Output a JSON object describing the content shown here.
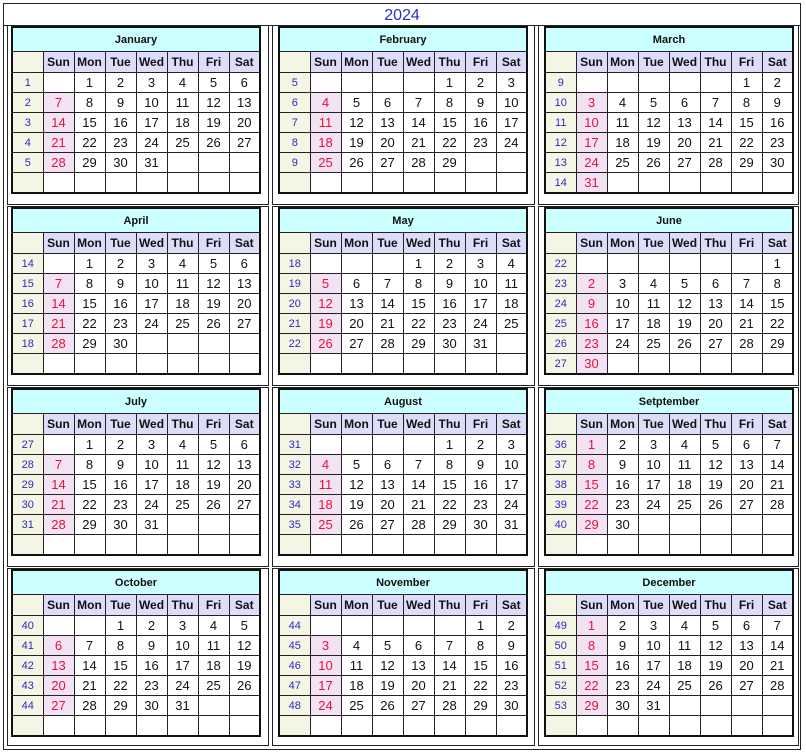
{
  "title": "2024",
  "day_headers": [
    "Sun",
    "Mon",
    "Tue",
    "Wed",
    "Thu",
    "Fri",
    "Sat"
  ],
  "months": [
    {
      "name": "January",
      "rows": [
        {
          "week": "1",
          "days": [
            "",
            "1",
            "2",
            "3",
            "4",
            "5",
            "6"
          ]
        },
        {
          "week": "2",
          "days": [
            "7",
            "8",
            "9",
            "10",
            "11",
            "12",
            "13"
          ]
        },
        {
          "week": "3",
          "days": [
            "14",
            "15",
            "16",
            "17",
            "18",
            "19",
            "20"
          ]
        },
        {
          "week": "4",
          "days": [
            "21",
            "22",
            "23",
            "24",
            "25",
            "26",
            "27"
          ]
        },
        {
          "week": "5",
          "days": [
            "28",
            "29",
            "30",
            "31",
            "",
            "",
            ""
          ]
        },
        {
          "week": "",
          "days": [
            "",
            "",
            "",
            "",
            "",
            "",
            ""
          ]
        }
      ]
    },
    {
      "name": "February",
      "rows": [
        {
          "week": "5",
          "days": [
            "",
            "",
            "",
            "",
            "1",
            "2",
            "3"
          ]
        },
        {
          "week": "6",
          "days": [
            "4",
            "5",
            "6",
            "7",
            "8",
            "9",
            "10"
          ]
        },
        {
          "week": "7",
          "days": [
            "11",
            "12",
            "13",
            "14",
            "15",
            "16",
            "17"
          ]
        },
        {
          "week": "8",
          "days": [
            "18",
            "19",
            "20",
            "21",
            "22",
            "23",
            "24"
          ]
        },
        {
          "week": "9",
          "days": [
            "25",
            "26",
            "27",
            "28",
            "29",
            "",
            ""
          ]
        },
        {
          "week": "",
          "days": [
            "",
            "",
            "",
            "",
            "",
            "",
            ""
          ]
        }
      ]
    },
    {
      "name": "March",
      "rows": [
        {
          "week": "9",
          "days": [
            "",
            "",
            "",
            "",
            "",
            "1",
            "2"
          ]
        },
        {
          "week": "10",
          "days": [
            "3",
            "4",
            "5",
            "6",
            "7",
            "8",
            "9"
          ]
        },
        {
          "week": "11",
          "days": [
            "10",
            "11",
            "12",
            "13",
            "14",
            "15",
            "16"
          ]
        },
        {
          "week": "12",
          "days": [
            "17",
            "18",
            "19",
            "20",
            "21",
            "22",
            "23"
          ]
        },
        {
          "week": "13",
          "days": [
            "24",
            "25",
            "26",
            "27",
            "28",
            "29",
            "30"
          ]
        },
        {
          "week": "14",
          "days": [
            "31",
            "",
            "",
            "",
            "",
            "",
            ""
          ]
        }
      ]
    },
    {
      "name": "April",
      "rows": [
        {
          "week": "14",
          "days": [
            "",
            "1",
            "2",
            "3",
            "4",
            "5",
            "6"
          ]
        },
        {
          "week": "15",
          "days": [
            "7",
            "8",
            "9",
            "10",
            "11",
            "12",
            "13"
          ]
        },
        {
          "week": "16",
          "days": [
            "14",
            "15",
            "16",
            "17",
            "18",
            "19",
            "20"
          ]
        },
        {
          "week": "17",
          "days": [
            "21",
            "22",
            "23",
            "24",
            "25",
            "26",
            "27"
          ]
        },
        {
          "week": "18",
          "days": [
            "28",
            "29",
            "30",
            "",
            "",
            "",
            ""
          ]
        },
        {
          "week": "",
          "days": [
            "",
            "",
            "",
            "",
            "",
            "",
            ""
          ]
        }
      ]
    },
    {
      "name": "May",
      "rows": [
        {
          "week": "18",
          "days": [
            "",
            "",
            "",
            "1",
            "2",
            "3",
            "4"
          ]
        },
        {
          "week": "19",
          "days": [
            "5",
            "6",
            "7",
            "8",
            "9",
            "10",
            "11"
          ]
        },
        {
          "week": "20",
          "days": [
            "12",
            "13",
            "14",
            "15",
            "16",
            "17",
            "18"
          ]
        },
        {
          "week": "21",
          "days": [
            "19",
            "20",
            "21",
            "22",
            "23",
            "24",
            "25"
          ]
        },
        {
          "week": "22",
          "days": [
            "26",
            "27",
            "28",
            "29",
            "30",
            "31",
            ""
          ]
        },
        {
          "week": "",
          "days": [
            "",
            "",
            "",
            "",
            "",
            "",
            ""
          ]
        }
      ]
    },
    {
      "name": "June",
      "rows": [
        {
          "week": "22",
          "days": [
            "",
            "",
            "",
            "",
            "",
            "",
            "1"
          ]
        },
        {
          "week": "23",
          "days": [
            "2",
            "3",
            "4",
            "5",
            "6",
            "7",
            "8"
          ]
        },
        {
          "week": "24",
          "days": [
            "9",
            "10",
            "11",
            "12",
            "13",
            "14",
            "15"
          ]
        },
        {
          "week": "25",
          "days": [
            "16",
            "17",
            "18",
            "19",
            "20",
            "21",
            "22"
          ]
        },
        {
          "week": "26",
          "days": [
            "23",
            "24",
            "25",
            "26",
            "27",
            "28",
            "29"
          ]
        },
        {
          "week": "27",
          "days": [
            "30",
            "",
            "",
            "",
            "",
            "",
            ""
          ]
        }
      ]
    },
    {
      "name": "July",
      "rows": [
        {
          "week": "27",
          "days": [
            "",
            "1",
            "2",
            "3",
            "4",
            "5",
            "6"
          ]
        },
        {
          "week": "28",
          "days": [
            "7",
            "8",
            "9",
            "10",
            "11",
            "12",
            "13"
          ]
        },
        {
          "week": "29",
          "days": [
            "14",
            "15",
            "16",
            "17",
            "18",
            "19",
            "20"
          ]
        },
        {
          "week": "30",
          "days": [
            "21",
            "22",
            "23",
            "24",
            "25",
            "26",
            "27"
          ]
        },
        {
          "week": "31",
          "days": [
            "28",
            "29",
            "30",
            "31",
            "",
            "",
            ""
          ]
        },
        {
          "week": "",
          "days": [
            "",
            "",
            "",
            "",
            "",
            "",
            ""
          ]
        }
      ]
    },
    {
      "name": "August",
      "rows": [
        {
          "week": "31",
          "days": [
            "",
            "",
            "",
            "",
            "1",
            "2",
            "3"
          ]
        },
        {
          "week": "32",
          "days": [
            "4",
            "5",
            "6",
            "7",
            "8",
            "9",
            "10"
          ]
        },
        {
          "week": "33",
          "days": [
            "11",
            "12",
            "13",
            "14",
            "15",
            "16",
            "17"
          ]
        },
        {
          "week": "34",
          "days": [
            "18",
            "19",
            "20",
            "21",
            "22",
            "23",
            "24"
          ]
        },
        {
          "week": "35",
          "days": [
            "25",
            "26",
            "27",
            "28",
            "29",
            "30",
            "31"
          ]
        },
        {
          "week": "",
          "days": [
            "",
            "",
            "",
            "",
            "",
            "",
            ""
          ]
        }
      ]
    },
    {
      "name": "Setptember",
      "rows": [
        {
          "week": "36",
          "days": [
            "1",
            "2",
            "3",
            "4",
            "5",
            "6",
            "7"
          ]
        },
        {
          "week": "37",
          "days": [
            "8",
            "9",
            "10",
            "11",
            "12",
            "13",
            "14"
          ]
        },
        {
          "week": "38",
          "days": [
            "15",
            "16",
            "17",
            "18",
            "19",
            "20",
            "21"
          ]
        },
        {
          "week": "39",
          "days": [
            "22",
            "23",
            "24",
            "25",
            "26",
            "27",
            "28"
          ]
        },
        {
          "week": "40",
          "days": [
            "29",
            "30",
            "",
            "",
            "",
            "",
            ""
          ]
        },
        {
          "week": "",
          "days": [
            "",
            "",
            "",
            "",
            "",
            "",
            ""
          ]
        }
      ]
    },
    {
      "name": "October",
      "rows": [
        {
          "week": "40",
          "days": [
            "",
            "",
            "1",
            "2",
            "3",
            "4",
            "5"
          ]
        },
        {
          "week": "41",
          "days": [
            "6",
            "7",
            "8",
            "9",
            "10",
            "11",
            "12"
          ]
        },
        {
          "week": "42",
          "days": [
            "13",
            "14",
            "15",
            "16",
            "17",
            "18",
            "19"
          ]
        },
        {
          "week": "43",
          "days": [
            "20",
            "21",
            "22",
            "23",
            "24",
            "25",
            "26"
          ]
        },
        {
          "week": "44",
          "days": [
            "27",
            "28",
            "29",
            "30",
            "31",
            "",
            ""
          ]
        },
        {
          "week": "",
          "days": [
            "",
            "",
            "",
            "",
            "",
            "",
            ""
          ]
        }
      ]
    },
    {
      "name": "November",
      "rows": [
        {
          "week": "44",
          "days": [
            "",
            "",
            "",
            "",
            "",
            "1",
            "2"
          ]
        },
        {
          "week": "45",
          "days": [
            "3",
            "4",
            "5",
            "6",
            "7",
            "8",
            "9"
          ]
        },
        {
          "week": "46",
          "days": [
            "10",
            "11",
            "12",
            "13",
            "14",
            "15",
            "16"
          ]
        },
        {
          "week": "47",
          "days": [
            "17",
            "18",
            "19",
            "20",
            "21",
            "22",
            "23"
          ]
        },
        {
          "week": "48",
          "days": [
            "24",
            "25",
            "26",
            "27",
            "28",
            "29",
            "30"
          ]
        },
        {
          "week": "",
          "days": [
            "",
            "",
            "",
            "",
            "",
            "",
            ""
          ]
        }
      ]
    },
    {
      "name": "December",
      "rows": [
        {
          "week": "49",
          "days": [
            "1",
            "2",
            "3",
            "4",
            "5",
            "6",
            "7"
          ]
        },
        {
          "week": "50",
          "days": [
            "8",
            "9",
            "10",
            "11",
            "12",
            "13",
            "14"
          ]
        },
        {
          "week": "51",
          "days": [
            "15",
            "16",
            "17",
            "18",
            "19",
            "20",
            "21"
          ]
        },
        {
          "week": "52",
          "days": [
            "22",
            "23",
            "24",
            "25",
            "26",
            "27",
            "28"
          ]
        },
        {
          "week": "53",
          "days": [
            "29",
            "30",
            "31",
            "",
            "",
            "",
            ""
          ]
        },
        {
          "week": "",
          "days": [
            "",
            "",
            "",
            "",
            "",
            "",
            ""
          ]
        }
      ]
    }
  ],
  "colors": {
    "title": "#2b2bd0",
    "month_header_bg": "#ccffff",
    "day_header_bg": "#ddddfa",
    "week_cell_bg": "#f5f5e6",
    "week_text": "#2a2ac0",
    "sunday_text": "#e8103c",
    "sunday_bg": "#f3e2f3"
  }
}
